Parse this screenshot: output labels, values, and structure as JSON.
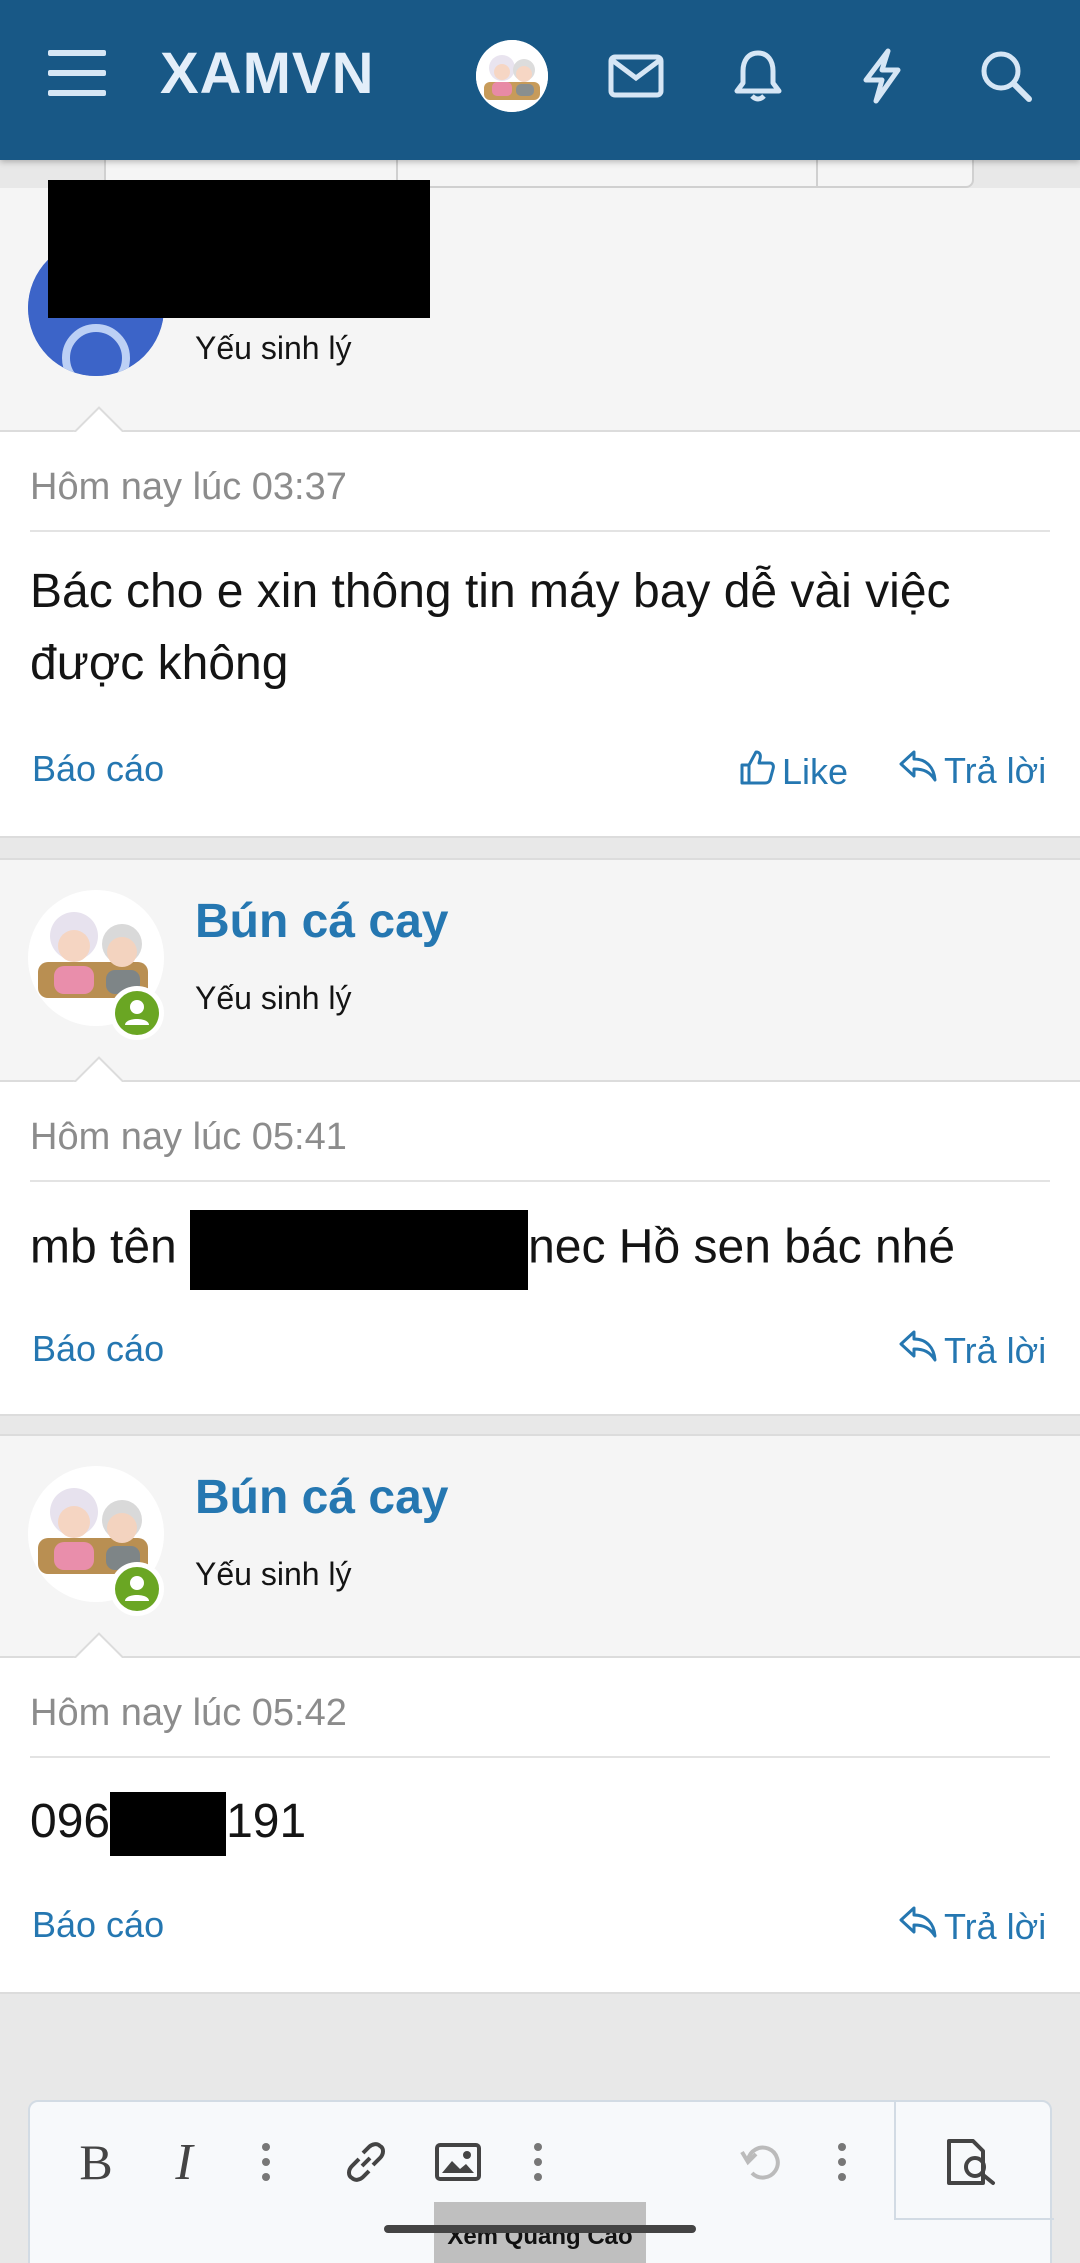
{
  "header": {
    "logo": "XAMVN",
    "icons": [
      "menu-icon",
      "avatar",
      "mail-icon",
      "bell-icon",
      "lightning-icon",
      "search-icon"
    ],
    "color": "#185886"
  },
  "posts": [
    {
      "username": "",
      "user_title": "Yếu sinh lý",
      "timestamp": "Hôm nay lúc 03:37",
      "message": "Bác cho e xin thông tin máy bay dễ vài việc được không",
      "report": "Báo cáo",
      "like": "Like",
      "reply": "Trả lời"
    },
    {
      "username": "Bún cá cay",
      "user_title": "Yếu sinh lý",
      "timestamp": "Hôm nay lúc 05:41",
      "message_prefix": "mb tên ",
      "message_suffix": "nec Hồ sen bác nhé",
      "report": "Báo cáo",
      "reply": "Trả lời"
    },
    {
      "username": "Bún cá cay",
      "user_title": "Yếu sinh lý",
      "timestamp": "Hôm nay lúc 05:42",
      "message_prefix": "096",
      "message_suffix": "191",
      "report": "Báo cáo",
      "reply": "Trả lời"
    }
  ],
  "editor": {
    "tools": [
      "bold-icon",
      "italic-icon",
      "more-icon",
      "link-icon",
      "image-icon",
      "more-icon",
      "undo-icon",
      "more-icon",
      "preview-icon"
    ]
  },
  "ad": {
    "label": "Xem Quảng Cáo"
  },
  "colors": {
    "link": "#2577b1",
    "online": "#6aa623",
    "header": "#185886"
  }
}
